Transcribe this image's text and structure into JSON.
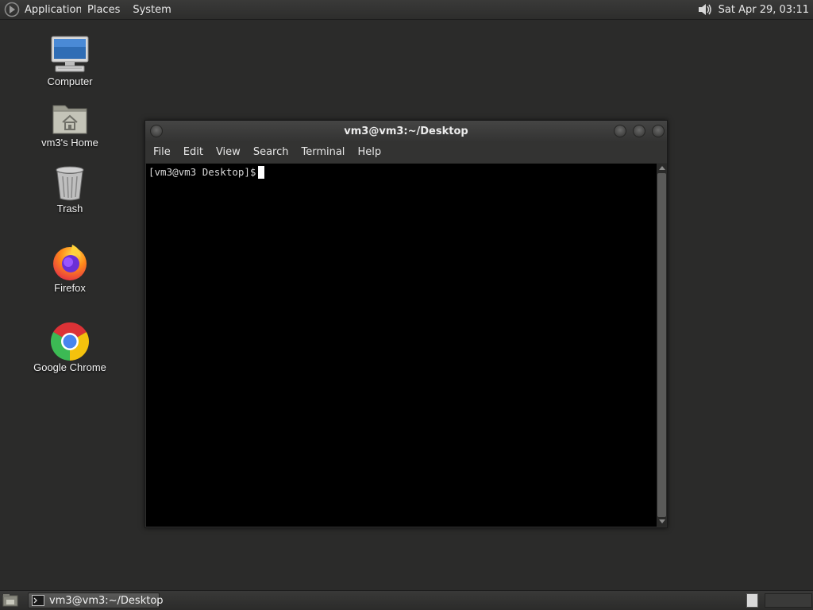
{
  "top_panel": {
    "menus": [
      "Applications",
      "Places",
      "System"
    ],
    "clock": "Sat Apr 29, 03:11"
  },
  "desktop": {
    "icons": [
      {
        "label": "Computer",
        "icon": "computer-icon"
      },
      {
        "label": "vm3's Home",
        "icon": "home-folder-icon"
      },
      {
        "label": "Trash",
        "icon": "trash-icon"
      },
      {
        "label": "Firefox",
        "icon": "firefox-icon"
      },
      {
        "label": "Google Chrome",
        "icon": "chrome-icon"
      }
    ]
  },
  "terminal": {
    "title": "vm3@vm3:~/Desktop",
    "menu": [
      "File",
      "Edit",
      "View",
      "Search",
      "Terminal",
      "Help"
    ],
    "prompt": "[vm3@vm3 Desktop]$"
  },
  "taskbar": {
    "window_button": "vm3@vm3:~/Desktop"
  },
  "colors": {
    "desktop_bg": "#2b2b2a",
    "panel": "#333332",
    "terminal_bg": "#000000"
  }
}
